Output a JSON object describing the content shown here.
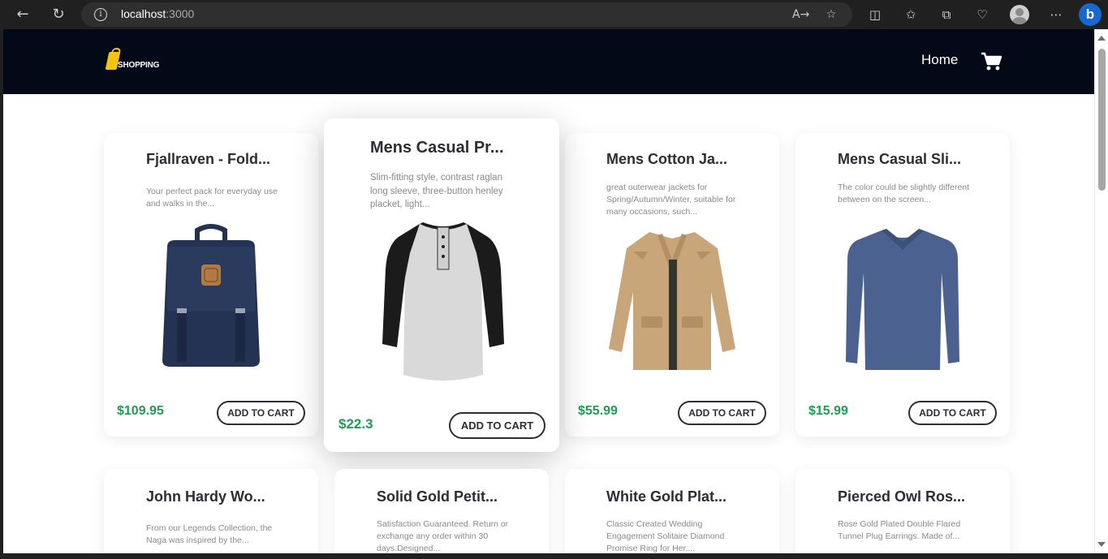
{
  "browser": {
    "url_host": "localhost",
    "url_port": ":3000"
  },
  "site": {
    "logo_text": "SHOPPING",
    "nav_home": "Home"
  },
  "colors": {
    "header_bg": "#040918",
    "price_green": "#1f9d55",
    "logo_yellow": "#f6c30b"
  },
  "products": [
    {
      "title": "Fjallraven - Fold...",
      "description": "Your perfect pack for everyday use and walks in the...",
      "price": "$109.95",
      "button": "ADD TO CART",
      "image": "backpack"
    },
    {
      "title": "Mens Casual Pr...",
      "description": "Slim-fitting style, contrast raglan long sleeve, three-button henley placket, light...",
      "price": "$22.3",
      "button": "ADD TO CART",
      "image": "raglan-shirt"
    },
    {
      "title": "Mens Cotton Ja...",
      "description": "great outerwear jackets for Spring/Autumn/Winter, suitable for many occasions, such...",
      "price": "$55.99",
      "button": "ADD TO CART",
      "image": "cotton-jacket"
    },
    {
      "title": "Mens Casual Sli...",
      "description": "The color could be slightly different between on the screen...",
      "price": "$15.99",
      "button": "ADD TO CART",
      "image": "long-sleeve-shirt"
    },
    {
      "title": "John Hardy Wo...",
      "description": "From our Legends Collection, the Naga was inspired by the..."
    },
    {
      "title": "Solid Gold Petit...",
      "description": "Satisfaction Guaranteed. Return or exchange any order within 30 days.Designed..."
    },
    {
      "title": "White Gold Plat...",
      "description": "Classic Created Wedding Engagement Solitaire Diamond Promise Ring for Her...."
    },
    {
      "title": "Pierced Owl Ros...",
      "description": "Rose Gold Plated Double Flared Tunnel Plug Earrings. Made of..."
    }
  ]
}
